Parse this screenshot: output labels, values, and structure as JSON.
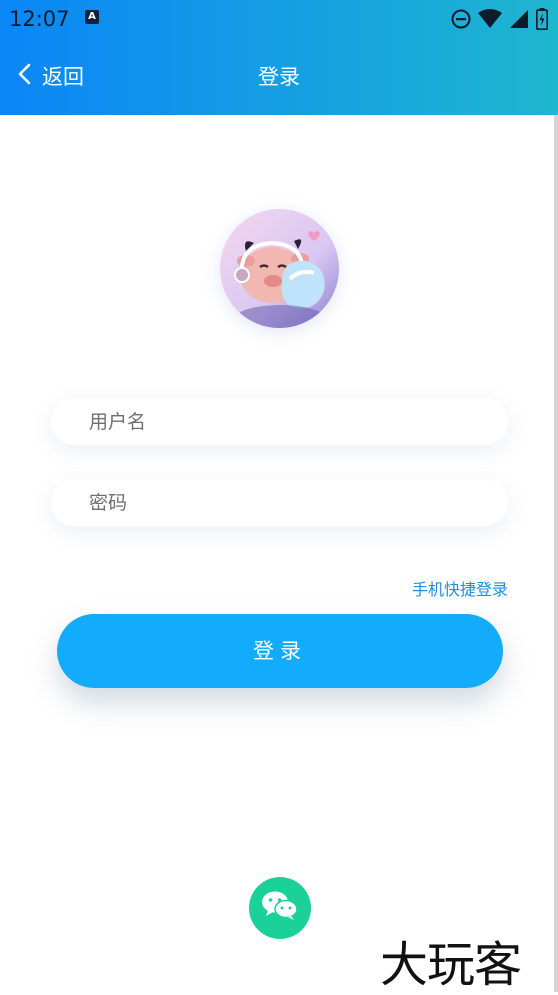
{
  "status_bar": {
    "time": "12:07",
    "app_icon_letter": "A",
    "icons": [
      "dnd-icon",
      "wifi-icon",
      "signal-icon",
      "battery-icon"
    ]
  },
  "nav": {
    "back_label": "返回",
    "title": "登录"
  },
  "form": {
    "username_placeholder": "用户名",
    "password_placeholder": "密码",
    "quick_login_label": "手机快捷登录",
    "login_button_label": "登录"
  },
  "social": {
    "wechat_icon": "wechat-icon"
  },
  "watermark": "大玩客",
  "colors": {
    "header_start": "#0a86f7",
    "header_end": "#1fb6cf",
    "primary_button": "#13abfb",
    "quick_link": "#1f8fe0",
    "wechat": "#1cd09a"
  }
}
